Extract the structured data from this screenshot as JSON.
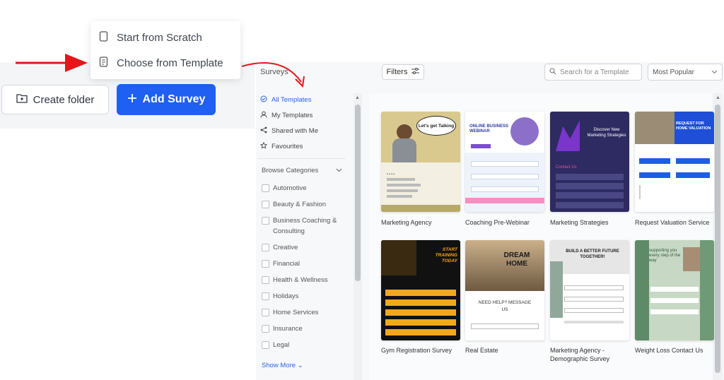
{
  "popup": {
    "scratch_label": "Start from Scratch",
    "template_label": "Choose from Template"
  },
  "buttons": {
    "create_folder": "Create folder",
    "add_survey": "Add Survey"
  },
  "panel": {
    "title": "Surveys",
    "filters_label": "Filters",
    "search_placeholder": "Search for a Template",
    "sort_selected": "Most Popular"
  },
  "sidebar": {
    "items": [
      {
        "label": "All Templates",
        "icon": "check-circle-icon"
      },
      {
        "label": "My Templates",
        "icon": "user-icon"
      },
      {
        "label": "Shared with Me",
        "icon": "share-icon"
      },
      {
        "label": "Favourites",
        "icon": "star-icon"
      }
    ],
    "browse_label": "Browse Categories",
    "categories": [
      "Automotive",
      "Beauty & Fashion",
      "Business Coaching & Consulting",
      "Creative",
      "Financial",
      "Health & Wellness",
      "Holidays",
      "Home Services",
      "Insurance",
      "Legal"
    ],
    "show_more": "Show More"
  },
  "templates": [
    {
      "name": "Marketing Agency",
      "thumb_text": "Let's get Talking"
    },
    {
      "name": "Coaching Pre-Webinar",
      "thumb_text": "ONLINE BUSINESS WEBINAR"
    },
    {
      "name": "Marketing Strategies",
      "thumb_text": "Discover New Marketing Strategies",
      "thumb_sub": "Contact Us"
    },
    {
      "name": "Request Valuation Service",
      "thumb_text": "REQUEST FOR HOME VALUATION"
    },
    {
      "name": "Gym Registration Survey",
      "thumb_text": "START TRAINING TODAY"
    },
    {
      "name": "Real Estate",
      "thumb_text": "DREAM HOME",
      "thumb_sub": "NEED HELP? MESSAGE US"
    },
    {
      "name": "Marketing Agency - Demographic Survey",
      "thumb_text": "BUILD A BETTER FUTURE TOGETHER!"
    },
    {
      "name": "Weight Loss Contact Us",
      "thumb_text": "supporting you every step of the way"
    }
  ],
  "colors": {
    "accent": "#1f5ff2",
    "arrow": "#e3161b"
  }
}
